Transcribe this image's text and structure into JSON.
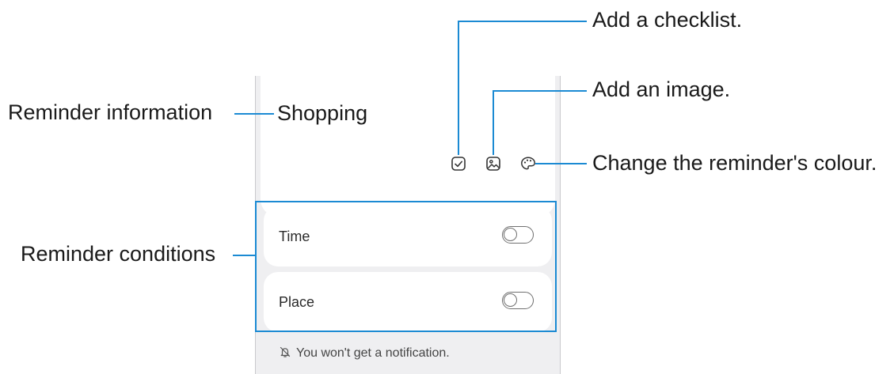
{
  "note": {
    "title": "Shopping",
    "toolbar": {
      "checklist_icon": "checkbox-icon",
      "image_icon": "image-icon",
      "colour_icon": "palette-icon"
    },
    "conditions": [
      {
        "label": "Time",
        "enabled": false
      },
      {
        "label": "Place",
        "enabled": false
      }
    ],
    "notification_text": "You won't get a notification."
  },
  "callouts": {
    "checklist": "Add a checklist.",
    "image": "Add an image.",
    "colour": "Change the reminder's colour.",
    "info": "Reminder information",
    "conditions": "Reminder conditions"
  },
  "colors": {
    "callout_line": "#1b8ad3",
    "screen_bg": "#efeff1",
    "card_bg": "#ffffff"
  }
}
